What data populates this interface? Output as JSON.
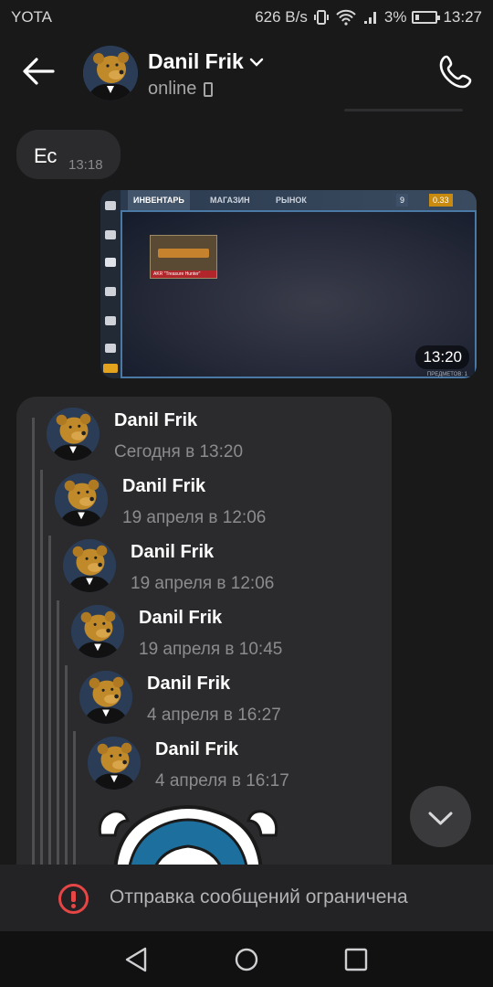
{
  "status_bar": {
    "carrier": "YOTA",
    "speed": "626 B/s",
    "battery": "3%",
    "time": "13:27"
  },
  "header": {
    "title": "Danil Frik",
    "subtitle": "online",
    "icons": {
      "back": "arrow-left-icon",
      "dropdown": "chevron-down-icon",
      "call": "phone-icon",
      "device": "mobile-device-icon"
    }
  },
  "messages": {
    "incoming_text": {
      "text": "Ес",
      "time": "13:18"
    },
    "photo": {
      "time": "13:20",
      "game": {
        "tab_1": "ИНВЕНТАРЬ",
        "tab_2": "МАГАЗИН",
        "tab_3": "РЫНОК",
        "currency_1": "9",
        "currency_2": "0.33",
        "item_label": "AKR \"Treasure Hunter\"",
        "footer": "ПРЕДМЕТОВ: 1"
      }
    },
    "forwarded": [
      {
        "name": "Danil Frik",
        "time": "Сегодня в 13:20"
      },
      {
        "name": "Danil Frik",
        "time": "19 апреля в 12:06"
      },
      {
        "name": "Danil Frik",
        "time": "19 апреля в 12:06"
      },
      {
        "name": "Danil Frik",
        "time": "19 апреля в 10:45"
      },
      {
        "name": "Danil Frik",
        "time": "4 апреля в 16:27"
      },
      {
        "name": "Danil Frik",
        "time": "4 апреля в 16:17"
      }
    ]
  },
  "bottom": {
    "restriction_text": "Отправка сообщений ограничена"
  },
  "colors": {
    "background": "#19191a",
    "bubble": "#2b2b2d",
    "alert": "#e64646",
    "muted": "#8c8c8f"
  }
}
